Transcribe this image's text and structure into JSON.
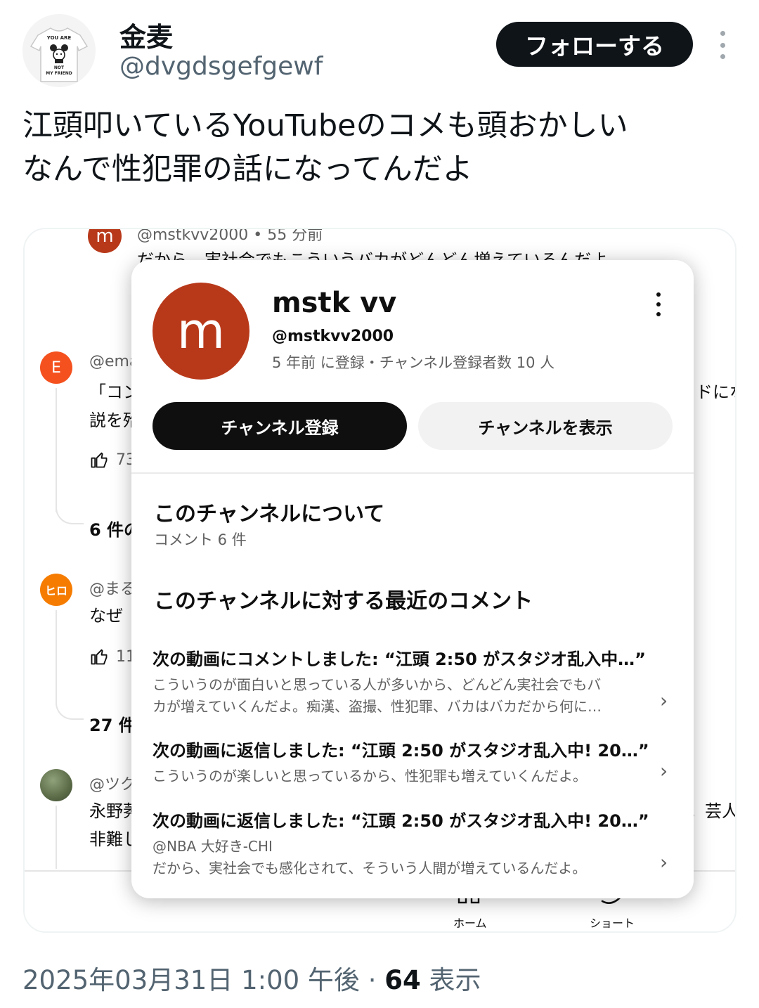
{
  "tweet": {
    "display_name": "金麦",
    "handle": "@dvgdsgefgewf",
    "follow_label": "フォローする",
    "avatar_text": [
      "YOU ARE",
      "NOT",
      "MY FRIEND"
    ],
    "text_line1": "江頭叩いているYouTubeのコメも頭おかしい",
    "text_line2": "なんで性犯罪の話になってんだよ",
    "timestamp": "2025年03月31日 1:00 午後",
    "separator": "·",
    "views_count": "64",
    "views_label": "表示"
  },
  "background": {
    "top_comment": {
      "avatar_letter": "m",
      "meta": "@mstkvv2000 • 55 分前",
      "text": "だから、実社会でもこういうバカがどんどん増えているんだよ。"
    },
    "comment_e": {
      "avatar_letter": "E",
      "handle_partial": "@ema",
      "line1_partial": "「コン",
      "line1_right": "ドにな",
      "line2_partial": "説を殆",
      "likes_partial": "73"
    },
    "replies_1": "6 件の",
    "comment_hiro": {
      "avatar_text": "ヒロ",
      "handle_partial": "@まる",
      "line1_partial": "なぜ",
      "likes_partial": "11"
    },
    "replies_2": "27 件",
    "comment_tsuku": {
      "handle_partial": "@ツク",
      "line1_partial": "永野莠",
      "line1_right": "。芸人",
      "line2_partial": "非難し"
    },
    "nav": {
      "home": "ホーム",
      "shorts": "ショート"
    }
  },
  "popover": {
    "avatar_letter": "m",
    "channel_name": "mstk vv",
    "channel_handle": "@mstkvv2000",
    "channel_meta": "5 年前 に登録・チャンネル登録者数 10 人",
    "subscribe_label": "チャンネル登録",
    "view_channel_label": "チャンネルを表示",
    "about_title": "このチャンネルについて",
    "about_count": "コメント 6 件",
    "recent_title": "このチャンネルに対する最近のコメント",
    "recent": [
      {
        "head": "次の動画にコメントしました: “江頭 2:50 がスタジオ乱入中…”",
        "line1": "こういうのが面白いと思っている人が多いから、どんどん実社会でもバ",
        "line2": "カが増えていくんだよ。痴漢、盗撮、性犯罪、バカはバカだから何に…"
      },
      {
        "head": "次の動画に返信しました: “江頭 2:50 がスタジオ乱入中! 20…”",
        "line1": "こういうのが楽しいと思っているから、性犯罪も増えていくんだよ。"
      },
      {
        "head": "次の動画に返信しました: “江頭 2:50 がスタジオ乱入中! 20…”",
        "line1": "@NBA 大好き-CHI",
        "line2": "だから、実社会でも感化されて、そういう人間が増えているんだよ。"
      }
    ]
  }
}
